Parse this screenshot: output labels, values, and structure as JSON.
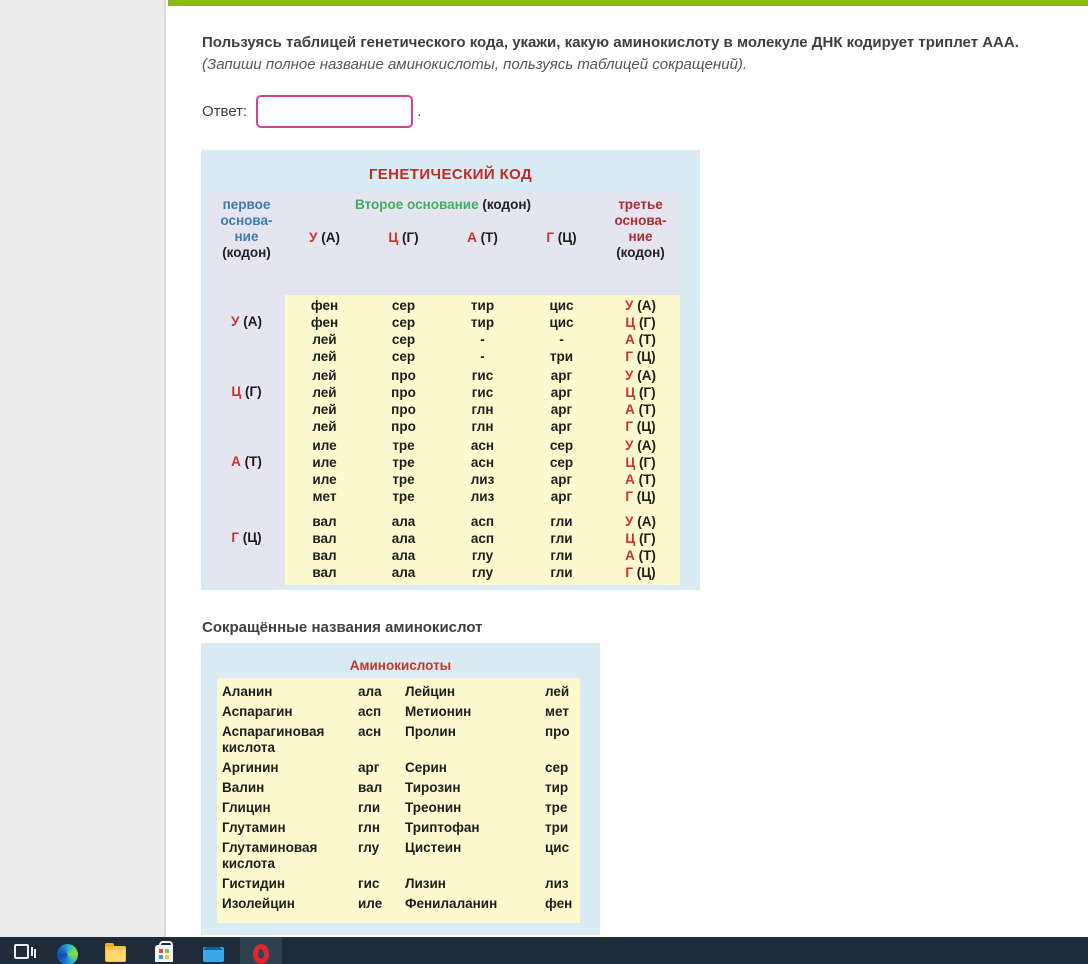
{
  "question": {
    "main": "Пользуясь таблицей генетического кода, укажи, какую аминокислоту в молекуле ДНК кодирует триплет ААА.",
    "note": "(Запиши полное название аминокислоты, пользуясь таблицей сокращений)."
  },
  "answer": {
    "label": "Ответ:",
    "value": "",
    "period": "."
  },
  "genetic_table": {
    "title": "ГЕНЕТИЧЕСКИЙ КОД",
    "first_base": {
      "line1": "первое",
      "line2": "основа-",
      "line3": "ние",
      "kodon": "(кодон)"
    },
    "second_base": {
      "label": "Второе основание",
      "kodon": "(кодон)"
    },
    "third_base": {
      "line1": "третье",
      "line2": "основа-",
      "line3": "ние",
      "kodon": "(кодон)"
    },
    "col_headers": [
      {
        "letter": "У",
        "paren": "(А)"
      },
      {
        "letter": "Ц",
        "paren": "(Г)"
      },
      {
        "letter": "А",
        "paren": "(Т)"
      },
      {
        "letter": "Г",
        "paren": "(Ц)"
      }
    ],
    "third_labels": [
      {
        "letter": "У",
        "paren": "(А)"
      },
      {
        "letter": "Ц",
        "paren": "(Г)"
      },
      {
        "letter": "А",
        "paren": "(Т)"
      },
      {
        "letter": "Г",
        "paren": "(Ц)"
      }
    ],
    "groups": [
      {
        "label": {
          "letter": "У",
          "paren": "(А)"
        },
        "rows": [
          [
            "фен",
            "сер",
            "тир",
            "цис"
          ],
          [
            "фен",
            "сер",
            "тир",
            "цис"
          ],
          [
            "лей",
            "сер",
            "-",
            "-"
          ],
          [
            "лей",
            "сер",
            "-",
            "три"
          ]
        ]
      },
      {
        "label": {
          "letter": "Ц",
          "paren": "(Г)"
        },
        "rows": [
          [
            "лей",
            "про",
            "гис",
            "арг"
          ],
          [
            "лей",
            "про",
            "гис",
            "арг"
          ],
          [
            "лей",
            "про",
            "глн",
            "арг"
          ],
          [
            "лей",
            "про",
            "глн",
            "арг"
          ]
        ]
      },
      {
        "label": {
          "letter": "А",
          "paren": "(Т)"
        },
        "rows": [
          [
            "иле",
            "тре",
            "асн",
            "сер"
          ],
          [
            "иле",
            "тре",
            "асн",
            "сер"
          ],
          [
            "иле",
            "тре",
            "лиз",
            "арг"
          ],
          [
            "мет",
            "тре",
            "лиз",
            "арг"
          ]
        ]
      },
      {
        "label": {
          "letter": "Г",
          "paren": "(Ц)"
        },
        "rows": [
          [
            "вал",
            "ала",
            "асп",
            "гли"
          ],
          [
            "вал",
            "ала",
            "асп",
            "гли"
          ],
          [
            "вал",
            "ала",
            "глу",
            "гли"
          ],
          [
            "вал",
            "ала",
            "глу",
            "гли"
          ]
        ]
      }
    ]
  },
  "amino_section": {
    "heading": "Сокращённые названия аминокислот",
    "table_title": "Аминокислоты",
    "rows": [
      {
        "n1": "Аланин",
        "a1": "ала",
        "n2": "Лейцин",
        "a2": "лей"
      },
      {
        "n1": "Аспарагин",
        "a1": "асп",
        "n2": "Метионин",
        "a2": "мет"
      },
      {
        "n1": "Аспарагиновая кислота",
        "a1": "асн",
        "n2": "Пролин",
        "a2": "про"
      },
      {
        "n1": "Аргинин",
        "a1": "арг",
        "n2": "Серин",
        "a2": "сер"
      },
      {
        "n1": "Валин",
        "a1": "вал",
        "n2": "Тирозин",
        "a2": "тир"
      },
      {
        "n1": "Глицин",
        "a1": "гли",
        "n2": "Треонин",
        "a2": "тре"
      },
      {
        "n1": "Глутамин",
        "a1": "глн",
        "n2": "Триптофан",
        "a2": "три"
      },
      {
        "n1": "Глутаминовая кислота",
        "a1": "глу",
        "n2": "Цистеин",
        "a2": "цис"
      },
      {
        "n1": "Гистидин",
        "a1": "гис",
        "n2": "Лизин",
        "a2": "лиз"
      },
      {
        "n1": "Изолейцин",
        "a1": "иле",
        "n2": "Фенилаланин",
        "a2": "фен"
      }
    ]
  },
  "taskbar": {
    "icons": [
      "task-view-icon",
      "edge-icon",
      "file-explorer-icon",
      "store-icon",
      "mail-icon",
      "opera-icon"
    ],
    "active_icon": "opera-icon"
  },
  "colors": {
    "accent_green": "#8cb71f",
    "input_border_pink": "#d6418f",
    "table_blue_bg": "#d9ebf2",
    "table_lavender_bg": "#e4e5f1",
    "table_yellow_bg": "#fcf9ce",
    "title_red": "#c42a28",
    "header_blue": "#3c7ab5",
    "header_green": "#3fae62",
    "header_dark_red": "#b02b2b",
    "taskbar_bg": "#1e2c3a"
  }
}
